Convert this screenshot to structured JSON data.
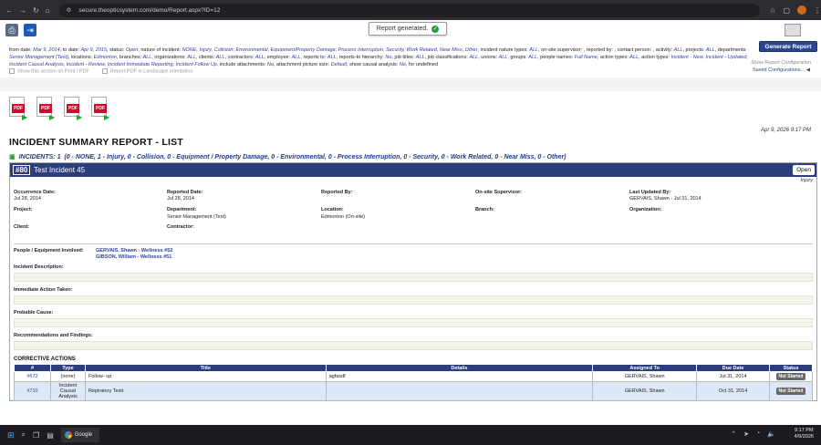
{
  "browser": {
    "url": "secure.theopticsystem.com/demo/Report.aspx?ID=12"
  },
  "toast": {
    "text": "Report generated."
  },
  "filters": [
    {
      "k": "from date:",
      "v": "Mar 9, 2014"
    },
    {
      "k": ", to date:",
      "v": "Apr 9, 2015"
    },
    {
      "k": ", status:",
      "v": "Open"
    },
    {
      "k": ", nature of incident:",
      "v": "NONE, Injury, Collision, Environmental, Equipment/Property Damage, Process Interruption, Security, Work Related, Near Miss, Other"
    },
    {
      "k": ", incident nature types:",
      "v": "ALL"
    },
    {
      "k": ", on-site supervisor: , reported by: , contact person: , activity:",
      "v": "ALL"
    },
    {
      "k": ", projects:",
      "v": "ALL"
    },
    {
      "k": ", departments:",
      "v": "Senior Management (Test)"
    },
    {
      "k": ", locations:",
      "v": "Edmonton"
    },
    {
      "k": ", branches:",
      "v": "ALL"
    },
    {
      "k": ", organizations:",
      "v": "ALL"
    },
    {
      "k": ", clients:",
      "v": "ALL"
    },
    {
      "k": ", contractors:",
      "v": "ALL"
    },
    {
      "k": ", employee:",
      "v": "ALL"
    },
    {
      "k": ", reports to:",
      "v": "ALL"
    },
    {
      "k": ", reports-to hierarchy:",
      "v": "No"
    },
    {
      "k": ", job titles:",
      "v": "ALL"
    },
    {
      "k": ", job classifications:",
      "v": "ALL"
    },
    {
      "k": ", unions:",
      "v": "ALL"
    },
    {
      "k": ", groups:",
      "v": "ALL"
    },
    {
      "k": ", people names:",
      "v": "Full Name"
    },
    {
      "k": ", action types:",
      "v": "ALL"
    },
    {
      "k": ", action types:",
      "v": "Incident - New, Incident - Updated, Incident Causal Analysis, Incident - Review, Incident Immediate Reporting, Incident Follow Up"
    },
    {
      "k": ", include attachments:",
      "v": "No"
    },
    {
      "k": ", attachment picture size:",
      "v": "Default"
    },
    {
      "k": ", show causal analysis:",
      "v": "No"
    },
    {
      "k": ", for undefined",
      "v": ""
    }
  ],
  "options": {
    "print_only": "Show this section on Print / PDF",
    "landscape": "Report PDF in Landscape orientation"
  },
  "buttons": {
    "generate": "Generate Report",
    "show_config": "Show Report Configuration",
    "saved_config": "Saved Configurations..."
  },
  "pdf_icons": [
    {
      "label": "PDF",
      "color": "#c8102e"
    },
    {
      "label": "PDF",
      "color": "#c8102e"
    },
    {
      "label": "PDF",
      "color": "#c8102e"
    },
    {
      "label": "PDF",
      "color": "#c8102e"
    }
  ],
  "report": {
    "date_stamp": "Apr 9, 2026 9:17 PM",
    "title": "INCIDENT SUMMARY REPORT - LIST",
    "incidents_label": "INCIDENTS: 1",
    "incidents_breakdown": "(0 - NONE, 1 - Injury, 0 - Collision, 0 - Equipment / Property Damage, 0 - Environmental, 0 - Process Interruption, 0 - Security, 0 - Work Related, 0 - Near Miss, 0 - Other)"
  },
  "incident": {
    "number": "#80",
    "title": "Test Incident 45",
    "status": "Open",
    "nature": "Injury",
    "fields": {
      "occurrence_date_label": "Occurrence Date:",
      "occurrence_date": "Jul 28, 2014",
      "reported_date_label": "Reported Date:",
      "reported_date": "Jul 28, 2014",
      "reported_by_label": "Reported By:",
      "supervisor_label": "On-site Supervisor:",
      "last_updated_label": "Last Updated By:",
      "last_updated": "GERVAIS, Shawn - Jul 31, 2014",
      "project_label": "Project:",
      "department_label": "Department:",
      "department": "Senior Management (Test)",
      "location_label": "Location:",
      "location": "Edmonton (On-site)",
      "branch_label": "Branch:",
      "organization_label": "Organization:",
      "client_label": "Client:",
      "contractor_label": "Contractor:"
    },
    "people_label": "People / Equipment Involved:",
    "people": [
      "GERVAIS, Shawn - Wellness #52",
      "GIBSON, William - Wellness #51"
    ],
    "sections": {
      "description": "Incident Description:",
      "immediate": "Immediate Action Taken:",
      "cause": "Probable Cause:",
      "recommendations": "Recommendations and Findings:"
    }
  },
  "corrective": {
    "title": "CORRECTIVE ACTIONS",
    "headers": [
      "#",
      "Type",
      "Title",
      "Details",
      "Assigned To",
      "Due Date",
      "Status"
    ],
    "rows": [
      {
        "id": "#672",
        "type": "(none)",
        "title": "Follow- up",
        "details": "agfasdf",
        "assigned": "GERVAIS, Shawn",
        "due": "Jul 31, 2014",
        "status": "Not Started"
      },
      {
        "id": "#710",
        "type": "Incident Causal Analysis",
        "title": "Repiratory Testt",
        "details": "",
        "assigned": "GERVAIS, Shawn",
        "due": "Oct 31, 2014",
        "status": "Not Started"
      }
    ]
  },
  "taskbar": {
    "app": "Google",
    "time": "9:17 PM",
    "date": "4/9/2026"
  }
}
